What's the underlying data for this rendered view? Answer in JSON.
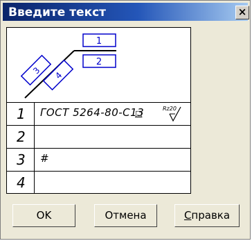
{
  "window": {
    "title": "Введите текст",
    "close_glyph": "×"
  },
  "diagram": {
    "top_label": "1",
    "bottom_label": "2",
    "left_diag_label": "3",
    "right_diag_label": "4"
  },
  "rows": [
    {
      "num": "1",
      "value": "ГОСТ 5264-80-С13",
      "weld_symbol": "□",
      "roughness": "Rz20"
    },
    {
      "num": "2",
      "value": ""
    },
    {
      "num": "3",
      "value": "#"
    },
    {
      "num": "4",
      "value": ""
    }
  ],
  "buttons": {
    "ok": "OK",
    "cancel": "Отмена",
    "help_prefix": "С",
    "help_rest": "правка"
  }
}
